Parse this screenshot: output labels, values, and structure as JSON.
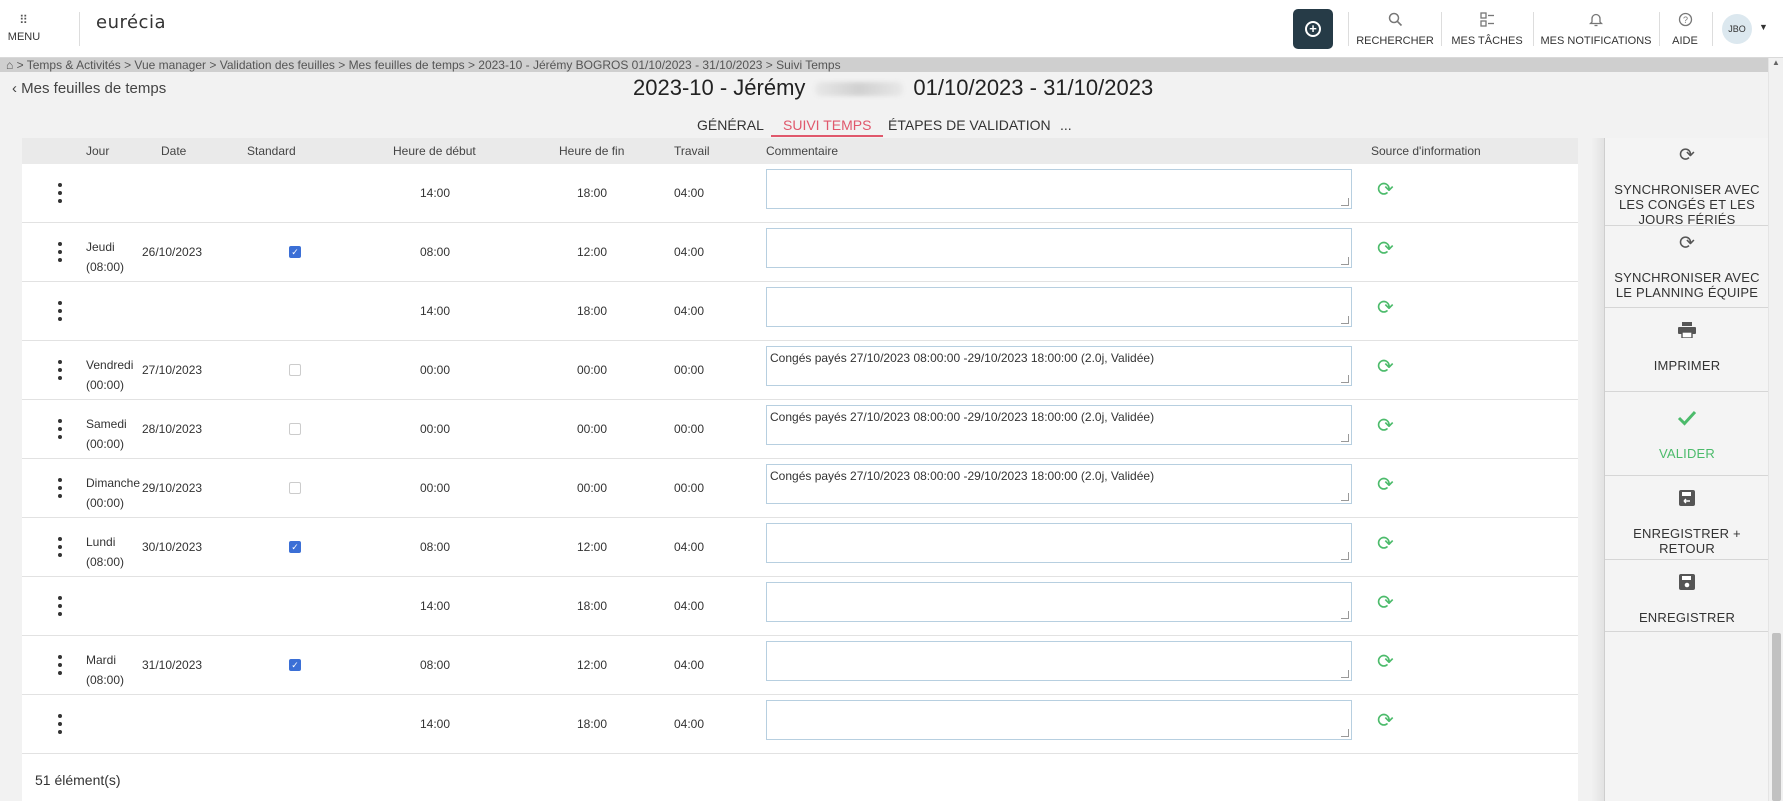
{
  "topbar": {
    "menu_label": "MENU",
    "logo": "eurécia",
    "add_icon": "plus-circle-icon",
    "tools": [
      {
        "label": "RECHERCHER",
        "icon": "search-icon"
      },
      {
        "label": "MES TÂCHES",
        "icon": "tasks-icon"
      },
      {
        "label": "MES NOTIFICATIONS",
        "icon": "bell-icon"
      },
      {
        "label": "AIDE",
        "icon": "help-icon"
      }
    ],
    "avatar_initials": "JBO"
  },
  "breadcrumb": "> Temps & Activités > Vue manager > Validation des feuilles > Mes feuilles de temps > 2023-10 - Jérémy BOGROS 01/10/2023 - 31/10/2023 > Suivi Temps",
  "header": {
    "back_label": "Mes feuilles de temps",
    "title_prefix": "2023-10 - Jérémy",
    "title_period": "01/10/2023 - 31/10/2023"
  },
  "tabs": [
    "GÉNÉRAL",
    "SUIVI TEMPS",
    "ÉTAPES DE VALIDATION",
    "..."
  ],
  "table": {
    "columns": [
      "Jour",
      "Date",
      "Standard",
      "Heure de début",
      "Heure de fin",
      "Travail",
      "Commentaire",
      "Source d'information"
    ],
    "rows": [
      {
        "day": "",
        "hours": "",
        "date": "",
        "standard": null,
        "start": "14:00",
        "end": "18:00",
        "work": "04:00",
        "comment": ""
      },
      {
        "day": "Jeudi",
        "hours": "(08:00)",
        "date": "26/10/2023",
        "standard": true,
        "start": "08:00",
        "end": "12:00",
        "work": "04:00",
        "comment": ""
      },
      {
        "day": "",
        "hours": "",
        "date": "",
        "standard": null,
        "start": "14:00",
        "end": "18:00",
        "work": "04:00",
        "comment": ""
      },
      {
        "day": "Vendredi",
        "hours": "(00:00)",
        "date": "27/10/2023",
        "standard": false,
        "start": "00:00",
        "end": "00:00",
        "work": "00:00",
        "comment": "Congés payés 27/10/2023 08:00:00 -29/10/2023 18:00:00 (2.0j, Validée)"
      },
      {
        "day": "Samedi",
        "hours": "(00:00)",
        "date": "28/10/2023",
        "standard": false,
        "start": "00:00",
        "end": "00:00",
        "work": "00:00",
        "comment": "Congés payés 27/10/2023 08:00:00 -29/10/2023 18:00:00 (2.0j, Validée)"
      },
      {
        "day": "Dimanche",
        "hours": "(00:00)",
        "date": "29/10/2023",
        "standard": false,
        "start": "00:00",
        "end": "00:00",
        "work": "00:00",
        "comment": "Congés payés 27/10/2023 08:00:00 -29/10/2023 18:00:00 (2.0j, Validée)"
      },
      {
        "day": "Lundi",
        "hours": "(08:00)",
        "date": "30/10/2023",
        "standard": true,
        "start": "08:00",
        "end": "12:00",
        "work": "04:00",
        "comment": ""
      },
      {
        "day": "",
        "hours": "",
        "date": "",
        "standard": null,
        "start": "14:00",
        "end": "18:00",
        "work": "04:00",
        "comment": ""
      },
      {
        "day": "Mardi",
        "hours": "(08:00)",
        "date": "31/10/2023",
        "standard": true,
        "start": "08:00",
        "end": "12:00",
        "work": "04:00",
        "comment": ""
      },
      {
        "day": "",
        "hours": "",
        "date": "",
        "standard": null,
        "start": "14:00",
        "end": "18:00",
        "work": "04:00",
        "comment": ""
      }
    ],
    "count_label": "51 élément(s)"
  },
  "actions": [
    {
      "label": "SYNCHRONISER AVEC LES CONGÉS ET LES JOURS FÉRIÉS",
      "icon": "sync-icon"
    },
    {
      "label": "SYNCHRONISER AVEC LE PLANNING ÉQUIPE",
      "icon": "sync-icon"
    },
    {
      "label": "IMPRIMER",
      "icon": "print-icon"
    },
    {
      "label": "VALIDER",
      "icon": "check-icon",
      "color": "#4cbb6b"
    },
    {
      "label": "ENREGISTRER + RETOUR",
      "icon": "save-return-icon"
    },
    {
      "label": "ENREGISTRER",
      "icon": "save-icon"
    }
  ],
  "colors": {
    "accent": "#e0586c",
    "success": "#4cbb6b",
    "dark_button": "#263b47"
  }
}
